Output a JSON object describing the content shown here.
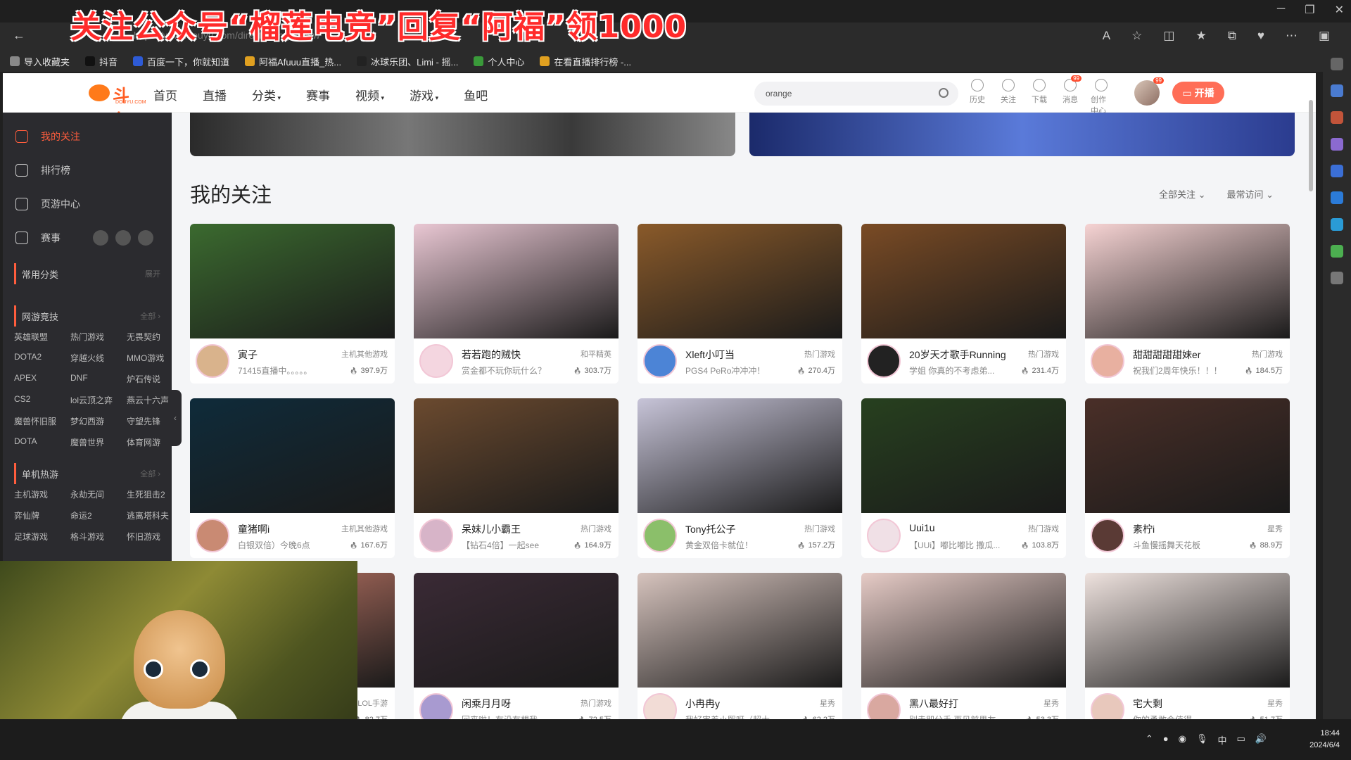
{
  "overlay_text": "关注公众号“榴莲电竞”回复“阿福”领1000",
  "browser": {
    "url": "https://www.douyu.com/directory/myFollow",
    "bookmarks": [
      "导入收藏夹",
      "抖音",
      "百度一下，你就知道",
      "阿福Afuuu直播_热...",
      "冰球乐团、Limi - 摇...",
      "个人中心",
      "在看直播排行榜 -..."
    ]
  },
  "nav": {
    "logo": "斗鱼",
    "logo_sub": "DOUYU.COM",
    "items": [
      "首页",
      "直播",
      "分类",
      "赛事",
      "视频",
      "游戏",
      "鱼吧"
    ],
    "search_value": "orange",
    "tools": [
      {
        "label": "历史",
        "icon": "clock-icon"
      },
      {
        "label": "关注",
        "icon": "heart-icon"
      },
      {
        "label": "下载",
        "icon": "download-icon"
      },
      {
        "label": "消息",
        "icon": "message-icon",
        "badge": "99"
      },
      {
        "label": "创作中心",
        "icon": "bulb-icon"
      }
    ],
    "avatar_badge": "99",
    "live_button": "开播"
  },
  "sidebar": {
    "main": [
      {
        "label": "我的关注",
        "active": true
      },
      {
        "label": "排行榜",
        "active": false
      },
      {
        "label": "页游中心",
        "active": false
      },
      {
        "label": "赛事",
        "active": false
      }
    ],
    "common": {
      "title": "常用分类",
      "more": "展开"
    },
    "mobile": {
      "title": "网游竞技",
      "more": "全部",
      "items": [
        "英雄联盟",
        "热门游戏",
        "无畏契约",
        "DOTA2",
        "穿越火线",
        "MMO游戏",
        "APEX",
        "DNF",
        "炉石传说",
        "CS2",
        "lol云顶之弈",
        "燕云十六声",
        "魔兽怀旧服",
        "梦幻西游",
        "守望先锋",
        "DOTA",
        "魔兽世界",
        "体育网游"
      ]
    },
    "single": {
      "title": "单机热游",
      "more": "全部",
      "items": [
        "主机游戏",
        "永劫无间",
        "生死狙击2",
        "弈仙牌",
        "命运2",
        "逃离塔科夫",
        "足球游戏",
        "格斗游戏",
        "怀旧游戏"
      ]
    }
  },
  "section": {
    "title": "我的关注",
    "filters": [
      "全部关注",
      "最常访问"
    ]
  },
  "cards": [
    {
      "name": "寅子",
      "category": "主机其他游戏",
      "desc": "71415直播中。。。。。",
      "heat": "397.9万",
      "thumb": "#3b6a2f",
      "av": "#d9b38c"
    },
    {
      "name": "若若跑的贼快",
      "category": "和平精英",
      "desc": "赏金都不玩你玩什么？",
      "heat": "303.7万",
      "thumb": "#e9c7d3",
      "av": "#f4d6e0"
    },
    {
      "name": "Xleft小叮当",
      "category": "热门游戏",
      "desc": "PGS4 PeRo冲冲冲！",
      "heat": "270.4万",
      "thumb": "#8a5a2a",
      "av": "#4c84d6"
    },
    {
      "name": "20岁天才歌手Running",
      "category": "热门游戏",
      "desc": "学姐 你真的不考虑弟...",
      "heat": "231.4万",
      "thumb": "#7a4b25",
      "av": "#222"
    },
    {
      "name": "甜甜甜甜甜妹er",
      "category": "热门游戏",
      "desc": "祝我们2周年快乐！！！",
      "heat": "184.5万",
      "thumb": "#f6d3d3",
      "av": "#e8b0a0"
    },
    {
      "name": "童猪啊i",
      "category": "主机其他游戏",
      "desc": "白银双倍）今晚6点",
      "heat": "167.6万",
      "thumb": "#0f2b3a",
      "av": "#c98a73"
    },
    {
      "name": "呆妹儿小霸王",
      "category": "热门游戏",
      "desc": "【钻石4倍】一起see",
      "heat": "164.9万",
      "thumb": "#6b4a2f",
      "av": "#d7b4c8"
    },
    {
      "name": "Tony托公子",
      "category": "热门游戏",
      "desc": "黄金双倍卡就位！",
      "heat": "157.2万",
      "thumb": "#c7c4d8",
      "av": "#8bbf6a"
    },
    {
      "name": "Uui1u",
      "category": "热门游戏",
      "desc": "【UUi】嘟比嘟比 撒瓜...",
      "heat": "103.8万",
      "thumb": "#27401f",
      "av": "#f0e0e6"
    },
    {
      "name": "素柠i",
      "category": "星秀",
      "desc": "斗鱼慢摇舞天花板",
      "heat": "88.9万",
      "thumb": "#4a2f28",
      "av": "#5a3a35"
    },
    {
      "name": "",
      "category": "LOL手游",
      "desc": "",
      "heat": "82.7万",
      "thumb": "#c77b6a",
      "av": "#999"
    },
    {
      "name": "闲乘月月呀",
      "category": "热门游戏",
      "desc": "回来啦！有没有想我",
      "heat": "72.5万",
      "thumb": "#3a2a35",
      "av": "#a89ad0"
    },
    {
      "name": "小冉冉y",
      "category": "星秀",
      "desc": "我好害羞小熙呀（超大...",
      "heat": "62.2万",
      "thumb": "#d6c3bd",
      "av": "#f2dcd6"
    },
    {
      "name": "黑八最好打",
      "category": "星秀",
      "desc": "别走即分手,再见前男友",
      "heat": "53.3万",
      "thumb": "#e6cbc6",
      "av": "#d9a8a0"
    },
    {
      "name": "宅大剩",
      "category": "星秀",
      "desc": "你的勇敢会值得",
      "heat": "51.7万",
      "thumb": "#eee2de",
      "av": "#e8c8bc"
    }
  ],
  "clock": {
    "time": "18:44",
    "date": "2024/6/4"
  },
  "tray_ime": "中"
}
